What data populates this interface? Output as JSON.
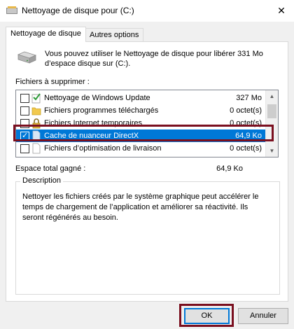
{
  "window": {
    "title": "Nettoyage de disque pour  (C:)",
    "close_glyph": "✕"
  },
  "tabs": [
    {
      "label": "Nettoyage de disque"
    },
    {
      "label": "Autres options"
    }
  ],
  "intro": "Vous pouvez utiliser le Nettoyage de disque pour libérer 331 Mo d’espace disque sur  (C:).",
  "files_label": "Fichiers à supprimer :",
  "files": [
    {
      "name": "Nettoyage de Windows Update",
      "size": "327 Mo",
      "checked": false,
      "icon": "windows-update-icon"
    },
    {
      "name": "Fichiers programmes téléchargés",
      "size": "0 octet(s)",
      "checked": false,
      "icon": "folder-icon"
    },
    {
      "name": "Fichiers Internet temporaires",
      "size": "0 octet(s)",
      "checked": false,
      "icon": "lock-icon"
    },
    {
      "name": "Cache de nuanceur DirectX",
      "size": "64,9 Ko",
      "checked": true,
      "selected": true,
      "icon": "file-icon"
    },
    {
      "name": "Fichiers d’optimisation de livraison",
      "size": "0 octet(s)",
      "checked": false,
      "icon": "file-icon"
    }
  ],
  "gain": {
    "label": "Espace total gagné :",
    "value": "64,9 Ko"
  },
  "description": {
    "title": "Description",
    "text": "Nettoyer les fichiers créés par le système graphique peut accélérer le temps de chargement de l’application et améliorer sa réactivité. Ils seront régénérés au besoin."
  },
  "buttons": {
    "ok": "OK",
    "cancel": "Annuler"
  },
  "colors": {
    "selection": "#0078d7",
    "highlight_frame": "#7a0f1f"
  }
}
